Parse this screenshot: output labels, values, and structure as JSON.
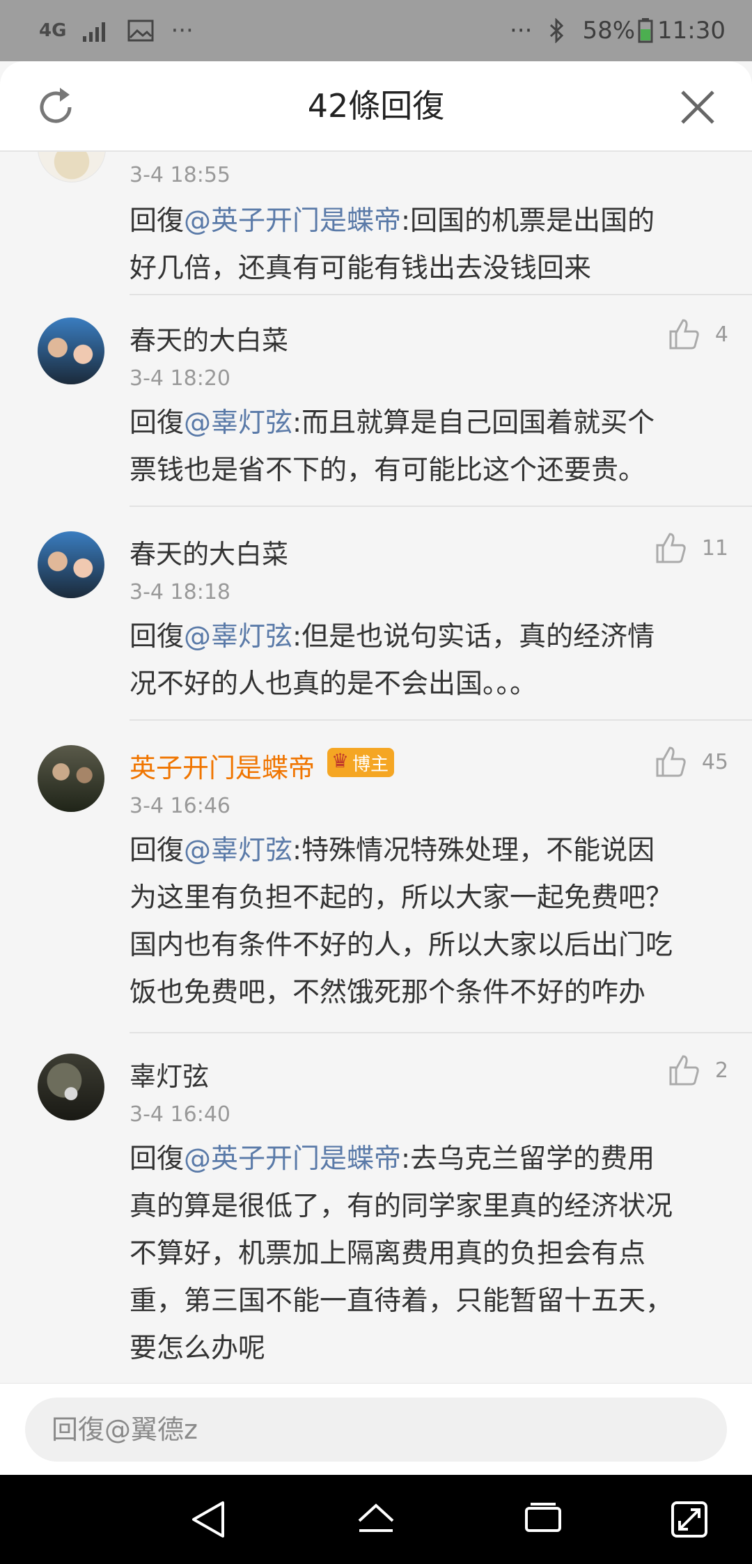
{
  "status_bar": {
    "network": "4G",
    "more": "···",
    "more_right": "···",
    "battery": "58%",
    "time": "11:30"
  },
  "header": {
    "title": "42條回復",
    "refresh_icon": "refresh-icon",
    "close_icon": "close-icon"
  },
  "comments": [
    {
      "time": "3-4 18:55",
      "reply_prefix": "回復",
      "mention": "@英子开门是蝶帝",
      "text_lines": [
        ":回国的机票是出国的",
        "好几倍，还真有可能有钱出去没钱回来"
      ]
    },
    {
      "name": "春天的大白菜",
      "time": "3-4 18:20",
      "likes": "4",
      "reply_prefix": "回復",
      "mention": "@辜灯弦",
      "text_lines": [
        ":而且就算是自己回国着就买个",
        "票钱也是省不下的，有可能比这个还要贵。"
      ]
    },
    {
      "name": "春天的大白菜",
      "time": "3-4 18:18",
      "likes": "11",
      "reply_prefix": "回復",
      "mention": "@辜灯弦",
      "text_lines": [
        ":但是也说句实话，真的经济情",
        "况不好的人也真的是不会出国。。。"
      ]
    },
    {
      "name": "英子开门是蝶帝",
      "badge": "博主",
      "time": "3-4 16:46",
      "likes": "45",
      "reply_prefix": "回復",
      "mention": "@辜灯弦",
      "text_lines": [
        ":特殊情况特殊处理，不能说因",
        "为这里有负担不起的，所以大家一起免费吧？",
        "国内也有条件不好的人，所以大家以后出门吃",
        "饭也免费吧，不然饿死那个条件不好的咋办"
      ]
    },
    {
      "name": "辜灯弦",
      "time": "3-4 16:40",
      "likes": "2",
      "reply_prefix": "回復",
      "mention": "@英子开门是蝶帝",
      "text_lines": [
        ":去乌克兰留学的费用",
        "真的算是很低了，有的同学家里真的经济状况",
        "不算好，机票加上隔离费用真的负担会有点",
        "重，第三国不能一直待着，只能暂留十五天，",
        "要怎么办呢"
      ]
    }
  ],
  "input": {
    "placeholder": "回復@翼德z"
  },
  "colors": {
    "mention": "#5a7aa8",
    "op_name": "#f07500",
    "badge": "#f5a623"
  }
}
